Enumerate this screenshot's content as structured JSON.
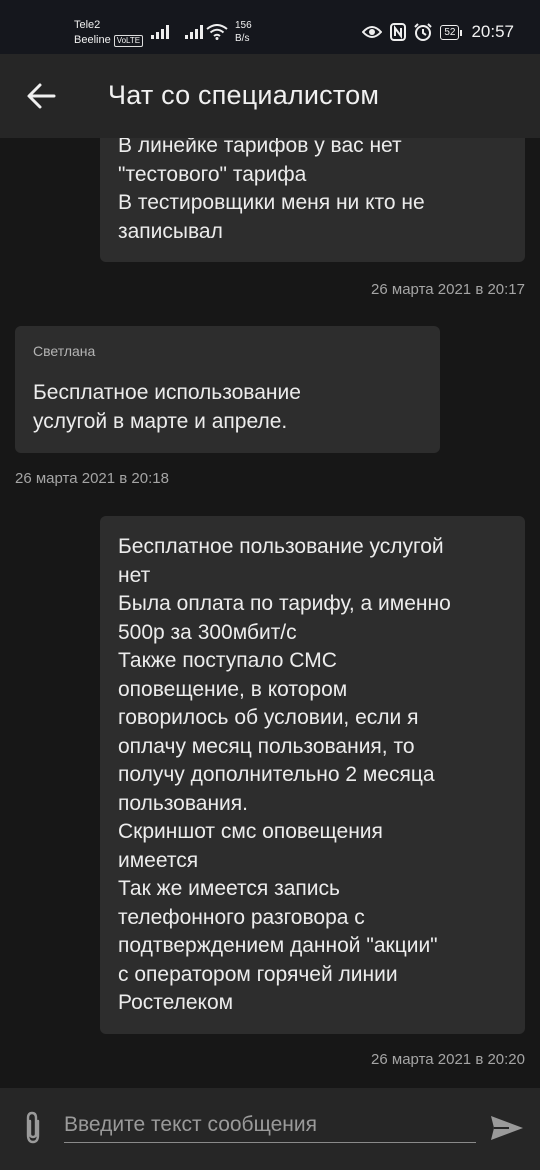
{
  "status_bar": {
    "carrier1": "Tele2",
    "carrier2": "Beeline",
    "volte_badge": "VoLTE",
    "net_speed_value": "156",
    "net_speed_unit": "B/s",
    "battery": "52",
    "time": "20:57",
    "icons": [
      "signal-icon",
      "signal-icon",
      "wifi-icon",
      "eye-icon",
      "nfc-icon",
      "alarm-icon",
      "battery-icon"
    ]
  },
  "header": {
    "title": "Чат со специалистом",
    "back_icon": "arrow-left-icon"
  },
  "messages": [
    {
      "direction": "outgoing",
      "text": "В линейке тарифов у вас нет\n\"тестового\" тарифа\nВ тестировщики  меня ни кто не\nзаписывал",
      "timestamp": "26 марта 2021 в 20:17"
    },
    {
      "direction": "incoming",
      "sender": "Светлана",
      "text": "Бесплатное использование\nуслугой в марте и апреле.",
      "timestamp": "26 марта 2021 в 20:18"
    },
    {
      "direction": "outgoing",
      "text": "Бесплатное пользование услугой\nнет\nБыла оплата по тарифу, а именно\n500р за 300мбит/с\nТакже поступало СМС\nоповещение, в котором\nговорилось об условии, если я\nоплачу месяц пользования, то\nполучу дополнительно 2 месяца\nпользования.\nСкриншот смс оповещения\nимеется\nТак же имеется запись\nтелефонного разговора с\nподтверждением данной \"акции\"\nс оператором горячей линии\nРостелеком",
      "timestamp": "26 марта 2021 в 20:20"
    }
  ],
  "composer": {
    "placeholder": "Введите текст сообщения",
    "attach_icon": "paperclip-icon",
    "send_icon": "send-icon"
  },
  "colors": {
    "background": "#171717",
    "bar": "#262626",
    "bubble": "#2d2d2d",
    "status_bar": "#15171d"
  }
}
